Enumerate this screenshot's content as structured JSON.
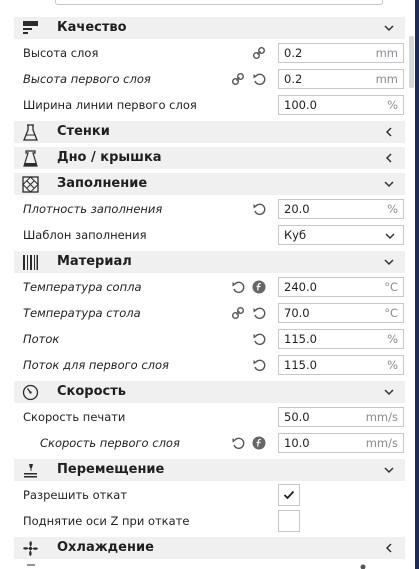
{
  "sections": {
    "quality": "Качество",
    "walls": "Стенки",
    "top_bottom": "Дно / крышка",
    "infill": "Заполнение",
    "material": "Материал",
    "speed": "Скорость",
    "travel": "Перемещение",
    "cooling": "Охлаждение"
  },
  "rows": {
    "layer_height": {
      "label": "Высота слоя",
      "value": "0.2",
      "unit": "mm"
    },
    "initial_layer_height": {
      "label": "Высота первого слоя",
      "value": "0.2",
      "unit": "mm"
    },
    "initial_line_width": {
      "label": "Ширина линии первого слоя",
      "value": "100.0",
      "unit": "%"
    },
    "infill_density": {
      "label": "Плотность заполнения",
      "value": "20.0",
      "unit": "%"
    },
    "infill_pattern": {
      "label": "Шаблон заполнения",
      "value": "Куб"
    },
    "nozzle_temp": {
      "label": "Температура сопла",
      "value": "240.0",
      "unit": "°C"
    },
    "bed_temp": {
      "label": "Температура стола",
      "value": "70.0",
      "unit": "°C"
    },
    "flow": {
      "label": "Поток",
      "value": "115.0",
      "unit": "%"
    },
    "initial_flow": {
      "label": "Поток для первого слоя",
      "value": "115.0",
      "unit": "%"
    },
    "print_speed": {
      "label": "Скорость печати",
      "value": "50.0",
      "unit": "mm/s"
    },
    "initial_speed": {
      "label": "Скорость первого слоя",
      "value": "10.0",
      "unit": "mm/s"
    },
    "retraction": {
      "label": "Разрешить откат",
      "checked": true
    },
    "z_hop": {
      "label": "Поднятие оси Z при откате",
      "checked": false
    }
  },
  "colors": {
    "section_bg": "#f0f0f0",
    "border": "#c5c7cc",
    "icon": "#555555",
    "accent": "#1e2a5a"
  }
}
